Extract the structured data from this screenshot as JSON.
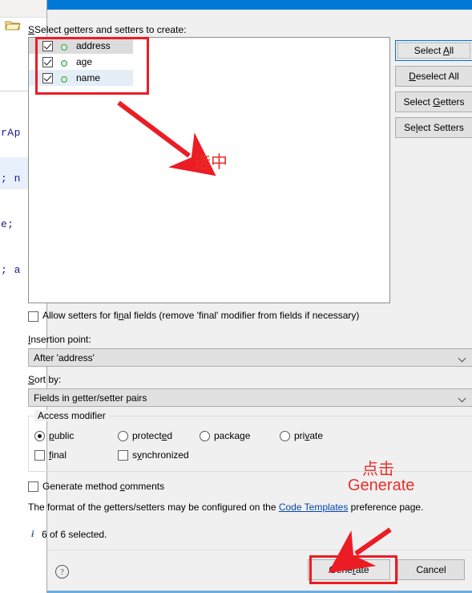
{
  "background_editor": {
    "folder_icon": "folder-icon",
    "code_lines": [
      "rAp",
      "; n",
      "e;",
      "; a"
    ]
  },
  "dialog": {
    "heading": "Select getters and setters to create:",
    "heading_mnemonic": "S",
    "tree": {
      "items": [
        {
          "label": "address",
          "checked": true,
          "state": "focus",
          "icon": "field-icon"
        },
        {
          "label": "age",
          "checked": true,
          "state": "normal",
          "icon": "field-icon"
        },
        {
          "label": "name",
          "checked": true,
          "state": "selected",
          "icon": "field-icon"
        }
      ]
    },
    "side_buttons": [
      {
        "label": "Select All",
        "mnemonic": "A",
        "default": true
      },
      {
        "label": "Deselect All",
        "mnemonic": "D",
        "default": false
      },
      {
        "label": "Select Getters",
        "mnemonic": "G",
        "default": false
      },
      {
        "label": "Select Setters",
        "mnemonic": "l",
        "default": false
      }
    ],
    "allow_setters": {
      "label": "Allow setters for final fields (remove 'final' modifier from fields if necessary)",
      "checked": false
    },
    "insertion_point": {
      "label": "Insertion point:",
      "value": "After 'address'"
    },
    "sort_by": {
      "label": "Sort by:",
      "value": "Fields in getter/setter pairs"
    },
    "access_modifier": {
      "title": "Access modifier",
      "radios": [
        {
          "label": "public",
          "selected": true
        },
        {
          "label": "protected",
          "selected": false
        },
        {
          "label": "package",
          "selected": false
        },
        {
          "label": "private",
          "selected": false
        }
      ],
      "checkboxes": [
        {
          "label": "final",
          "checked": false
        },
        {
          "label": "synchronized",
          "checked": false
        }
      ]
    },
    "generate_comments": {
      "label": "Generate method comments",
      "checked": false
    },
    "format_note": {
      "prefix": "The format of the getters/setters may be configured on the ",
      "link": "Code Templates",
      "suffix": " preference page."
    },
    "status": {
      "icon": "info-icon",
      "text": "6 of 6 selected."
    },
    "footer": {
      "help_icon": "help-icon",
      "generate_label": "Generate",
      "cancel_label": "Cancel"
    }
  },
  "annotations": {
    "select_note": "选中",
    "click_note_line1": "点击",
    "click_note_line2": "Generate",
    "highlight_color": "#ec1c24",
    "text_color": "#e8302a"
  }
}
